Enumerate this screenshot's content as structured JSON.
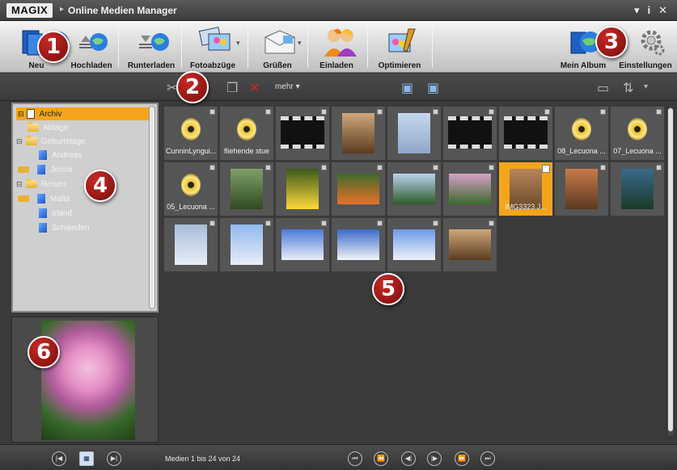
{
  "titlebar": {
    "logo": "MAGIX",
    "title": "Online Medien Manager"
  },
  "toolbar": {
    "buttons": [
      {
        "label": "Neu",
        "icon": "book-globe-icon"
      },
      {
        "label": "Hochladen",
        "icon": "upload-icon"
      },
      {
        "label": "Runterladen",
        "icon": "download-icon"
      },
      {
        "label": "Fotoabzüge",
        "icon": "photo-prints-icon"
      },
      {
        "label": "Grüßen",
        "icon": "envelope-icon"
      },
      {
        "label": "Einladen",
        "icon": "people-icon"
      },
      {
        "label": "Optimieren",
        "icon": "optimize-icon"
      },
      {
        "label": "Mein Album",
        "icon": "album-icon"
      },
      {
        "label": "Einstellungen",
        "icon": "gear-icon"
      }
    ]
  },
  "toolbar2": {
    "more_label": "mehr"
  },
  "callouts": [
    "1",
    "2",
    "3",
    "4",
    "5",
    "6"
  ],
  "tree": {
    "items": [
      {
        "label": "Archiv"
      },
      {
        "label": "Ablage"
      },
      {
        "label": "Geburtstage"
      },
      {
        "label": "Andreas"
      },
      {
        "label": "Jenna"
      },
      {
        "label": "Reisen"
      },
      {
        "label": "Malta"
      },
      {
        "label": "Irland"
      },
      {
        "label": "Schweden"
      }
    ]
  },
  "grid": {
    "items": [
      {
        "type": "audio",
        "caption": "CunninLyngui..."
      },
      {
        "type": "audio",
        "caption": "fliehende stue"
      },
      {
        "type": "video",
        "caption": ""
      },
      {
        "type": "photo",
        "caption": ""
      },
      {
        "type": "photo",
        "caption": ""
      },
      {
        "type": "video",
        "caption": ""
      },
      {
        "type": "video",
        "caption": ""
      },
      {
        "type": "audio",
        "caption": "08_Lecuona ..."
      },
      {
        "type": "audio",
        "caption": "07_Lecuona ..."
      },
      {
        "type": "audio",
        "caption": "05_Lecuona ..."
      },
      {
        "type": "photo",
        "caption": ""
      },
      {
        "type": "photo",
        "caption": ""
      },
      {
        "type": "photo",
        "caption": ""
      },
      {
        "type": "photo",
        "caption": ""
      },
      {
        "type": "photo",
        "caption": ""
      },
      {
        "type": "photo",
        "caption": "IMG3323.J..."
      },
      {
        "type": "photo",
        "caption": ""
      },
      {
        "type": "photo",
        "caption": ""
      },
      {
        "type": "photo",
        "caption": ""
      },
      {
        "type": "photo",
        "caption": ""
      },
      {
        "type": "photo",
        "caption": ""
      },
      {
        "type": "photo",
        "caption": ""
      },
      {
        "type": "photo",
        "caption": ""
      },
      {
        "type": "photo",
        "caption": ""
      }
    ]
  },
  "status": {
    "text": "Medien 1 bis 24 von 24"
  },
  "colors": {
    "selection": "#f4a51c",
    "callout": "#a81c18"
  }
}
